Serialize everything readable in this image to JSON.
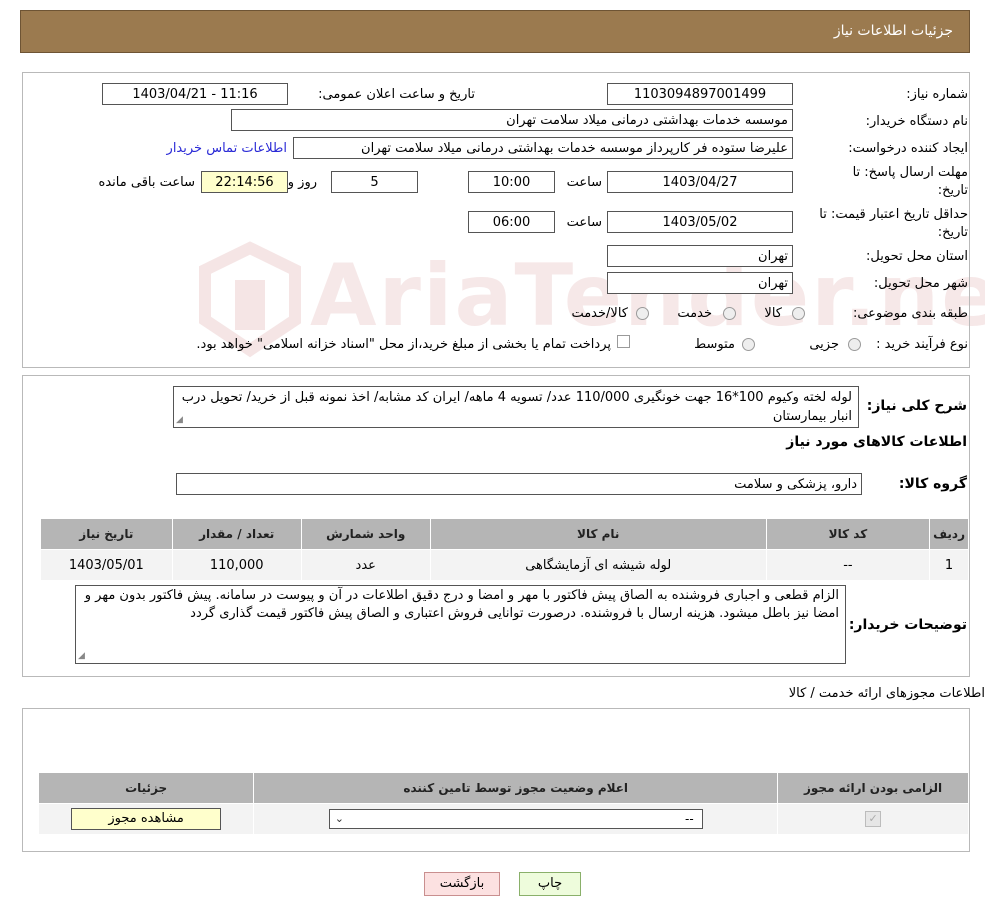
{
  "header": {
    "title": "جزئیات اطلاعات نیاز"
  },
  "watermark": {
    "text": "AriaTender.neT"
  },
  "info": {
    "need_number_label": "شماره نیاز:",
    "need_number": "1103094897001499",
    "announce_label": "تاریخ و ساعت اعلان عمومی:",
    "announce_value": "1403/04/21 - 11:16",
    "buyer_org_label": "نام دستگاه خریدار:",
    "buyer_org": "موسسه خدمات بهداشتی درمانی میلاد سلامت تهران",
    "creator_label": "ایجاد کننده درخواست:",
    "creator": "علیرضا ستوده فر کارپرداز موسسه خدمات بهداشتی درمانی میلاد سلامت تهران",
    "contact_link": "اطلاعات تماس خریدار",
    "deadline_label_1": "مهلت ارسال پاسخ: تا",
    "deadline_label_2": "تاریخ:",
    "deadline_date": "1403/04/27",
    "time_label": "ساعت",
    "deadline_time": "10:00",
    "days_value": "5",
    "days_label": "روز و",
    "remaining_time": "22:14:56",
    "remaining_label": "ساعت باقی مانده",
    "validity_label_1": "حداقل تاریخ اعتبار قیمت: تا",
    "validity_label_2": "تاریخ:",
    "validity_date": "1403/05/02",
    "validity_time": "06:00",
    "province_label": "استان محل تحویل:",
    "province": "تهران",
    "city_label": "شهر محل تحویل:",
    "city": "تهران",
    "category_label": "طبقه بندی موضوعی:",
    "category_options": [
      "کالا",
      "خدمت",
      "کالا/خدمت"
    ],
    "process_label": "نوع فرآیند خرید :",
    "process_options": [
      "جزیی",
      "متوسط"
    ],
    "process_note": "پرداخت تمام یا بخشی از مبلغ خرید،از محل \"اسناد خزانه اسلامی\" خواهد بود."
  },
  "summary": {
    "label": "شرح کلی نیاز:",
    "text": "لوله لخته  وکیوم 100*16 جهت خونگیری 110/000 عدد/ تسویه 4 ماهه/ ایران کد مشابه/ اخذ نمونه قبل از خرید/ تحویل درب انبار بیمارستان",
    "goods_title": "اطلاعات کالاهای مورد نیاز",
    "group_label": "گروه کالا:",
    "group_value": "دارو، پزشکی و سلامت"
  },
  "goods_table": {
    "headers": [
      "ردیف",
      "کد کالا",
      "نام کالا",
      "واحد شمارش",
      "تعداد / مقدار",
      "تاریخ نیاز"
    ],
    "rows": [
      [
        "1",
        "--",
        "لوله شیشه ای آزمایشگاهی",
        "عدد",
        "110,000",
        "1403/05/01"
      ]
    ]
  },
  "buyer_notes": {
    "label": "توضیحات خریدار:",
    "text": "الزام قطعی و اجباری فروشنده به الصاق پیش فاکتور با مهر و امضا و درج دقیق اطلاعات در آن و پیوست در سامانه. پیش فاکتور بدون مهر و امضا نیز باطل میشود. هزینه ارسال با فروشنده. درصورت توانایی فروش اعتباری و الصاق پیش فاکتور قیمت گذاری گردد"
  },
  "permits": {
    "title": "اطلاعات مجوزهای ارائه خدمت / کالا",
    "headers": [
      "الزامی بودن ارائه مجوز",
      "اعلام وضعیت مجوز توسط تامین کننده",
      "جزئیات"
    ],
    "select_value": "--",
    "view_button": "مشاهده مجوز"
  },
  "actions": {
    "print": "چاپ",
    "back": "بازگشت"
  }
}
